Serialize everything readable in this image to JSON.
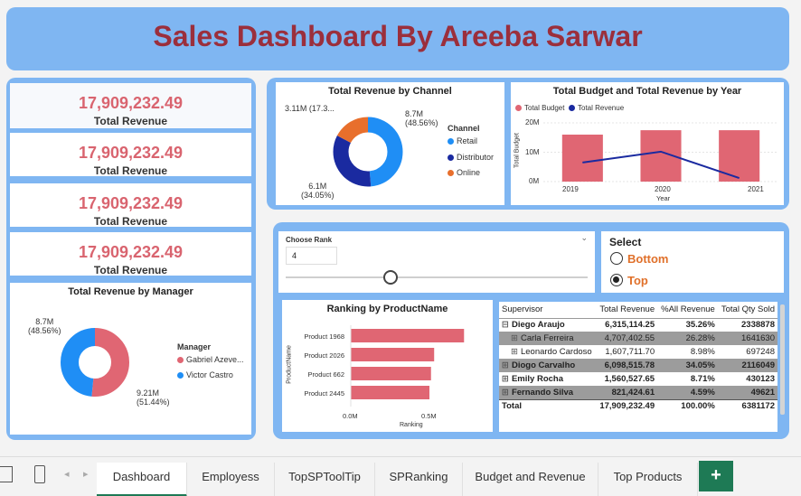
{
  "title": "Sales Dashboard By Areeba Sarwar",
  "kpis": [
    {
      "value": "17,909,232.49",
      "label": "Total Revenue"
    },
    {
      "value": "17,909,232.49",
      "label": "Total Revenue"
    },
    {
      "value": "17,909,232.49",
      "label": "Total Revenue"
    },
    {
      "value": "17,909,232.49",
      "label": "Total Revenue"
    }
  ],
  "colors": {
    "panel": "#7fb6f2",
    "title": "#9b2f3c",
    "kpi": "#d9646f",
    "blue": "#1f8ef5",
    "navy": "#1a2aa0",
    "orange": "#e86f2c",
    "bar": "#e06673",
    "line": "#1a2aa0"
  },
  "manager_chart": {
    "title": "Total Revenue by Manager",
    "legend_title": "Manager",
    "labels": {
      "left": "8.7M",
      "left_pct": "(48.56%)",
      "right": "9.21M",
      "right_pct": "(51.44%)"
    },
    "legend": [
      "Gabriel Azeve...",
      "Victor Castro"
    ]
  },
  "channel_chart": {
    "title": "Total Revenue by Channel",
    "legend_title": "Channel",
    "legend": [
      "Retail",
      "Distributor",
      "Online"
    ],
    "labels": {
      "online": "3.11M (17.3...",
      "retail": "8.7M",
      "retail_pct": "(48.56%)",
      "dist": "6.1M",
      "dist_pct": "(34.05%)"
    }
  },
  "budget_chart": {
    "title": "Total Budget and Total Revenue by Year",
    "legend": [
      "Total Budget",
      "Total Revenue"
    ],
    "ylabel": "Total Budget",
    "xlabel": "Year",
    "yticks": [
      "20M",
      "10M",
      "0M"
    ],
    "xticks": [
      "2019",
      "2020",
      "2021"
    ]
  },
  "chart_data": [
    {
      "type": "pie",
      "title": "Total Revenue by Manager",
      "categories": [
        "Gabriel Azeve...",
        "Victor Castro"
      ],
      "values": [
        9.21,
        8.7
      ],
      "unit": "M"
    },
    {
      "type": "pie",
      "title": "Total Revenue by Channel",
      "categories": [
        "Retail",
        "Distributor",
        "Online"
      ],
      "values": [
        8.7,
        6.1,
        3.11
      ],
      "unit": "M"
    },
    {
      "type": "bar",
      "title": "Total Budget and Total Revenue by Year",
      "categories": [
        "2019",
        "2020",
        "2021"
      ],
      "series": [
        {
          "name": "Total Budget",
          "values": [
            16,
            17.5,
            17.5
          ]
        },
        {
          "name": "Total Revenue",
          "values": [
            6.5,
            10.2,
            1.2
          ]
        }
      ],
      "ylim": [
        0,
        20
      ],
      "xlabel": "Year",
      "ylabel": "Total Budget"
    },
    {
      "type": "bar",
      "title": "Ranking by ProductName",
      "categories": [
        "Product 1968",
        "Product 2026",
        "Product 662",
        "Product 2445"
      ],
      "values": [
        0.72,
        0.53,
        0.51,
        0.5
      ],
      "xlabel": "Ranking",
      "ylabel": "ProductName",
      "xticks": [
        "0.0M",
        "0.5M"
      ]
    }
  ],
  "rank_slicer": {
    "label": "Choose Rank",
    "value": "4"
  },
  "select": {
    "title": "Select",
    "options": [
      "Bottom",
      "Top"
    ],
    "selected": "Top"
  },
  "ranking_chart": {
    "title": "Ranking by ProductName",
    "xlabel": "Ranking",
    "ylabel": "ProductName",
    "xticks": [
      "0.0M",
      "0.5M"
    ],
    "products": [
      "Product 1968",
      "Product 2026",
      "Product 662",
      "Product 2445"
    ]
  },
  "matrix": {
    "headers": [
      "Supervisor",
      "Total Revenue",
      "%All Revenue",
      "Total Qty Sold"
    ],
    "rows": [
      {
        "name": "Diego Araujo",
        "rev": "6,315,114.25",
        "pct": "35.26%",
        "qty": "2338878",
        "style": "bold",
        "expand": "⊟"
      },
      {
        "name": "Carla Ferreira",
        "rev": "4,707,402.55",
        "pct": "26.28%",
        "qty": "1641630",
        "style": "grey",
        "expand": "⊞"
      },
      {
        "name": "Leonardo Cardoso",
        "rev": "1,607,711.70",
        "pct": "8.98%",
        "qty": "697248",
        "style": "plain",
        "expand": "⊞"
      },
      {
        "name": "Diogo Carvalho",
        "rev": "6,098,515.78",
        "pct": "34.05%",
        "qty": "2116049",
        "style": "boldgrey",
        "expand": "⊞"
      },
      {
        "name": "Emily Rocha",
        "rev": "1,560,527.65",
        "pct": "8.71%",
        "qty": "430123",
        "style": "bold",
        "expand": "⊞"
      },
      {
        "name": "Fernando Silva",
        "rev": "821,424.61",
        "pct": "4.59%",
        "qty": "49621",
        "style": "boldgrey",
        "expand": "⊞"
      }
    ],
    "total": {
      "name": "Total",
      "rev": "17,909,232.49",
      "pct": "100.00%",
      "qty": "6381172"
    }
  },
  "tabs": [
    "Dashboard",
    "Employess",
    "TopSPToolTip",
    "SPRanking",
    "Budget and Revenue",
    "Top Products"
  ],
  "add_tab": "+"
}
